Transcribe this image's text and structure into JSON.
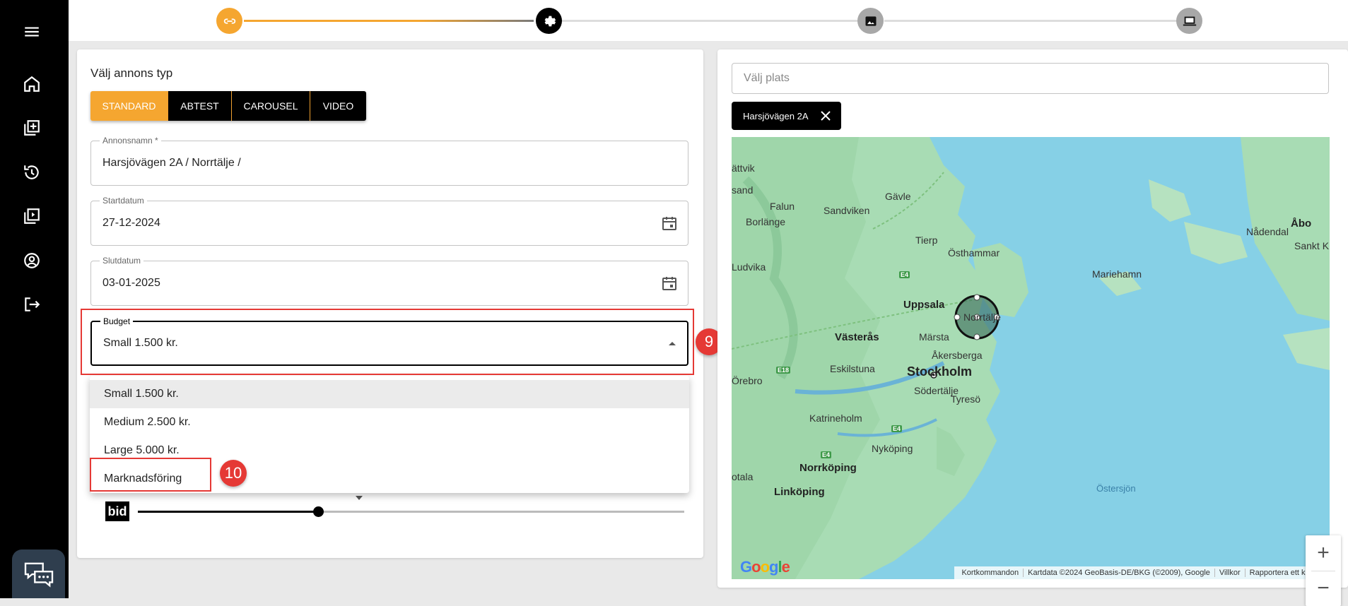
{
  "sidebar": {
    "icons": [
      "menu-icon",
      "home-icon",
      "add-ad-icon",
      "history-icon",
      "video-library-icon",
      "account-icon",
      "logout-icon"
    ],
    "chat": "chat-icon"
  },
  "stepper": {
    "steps": [
      "link-icon",
      "settings-icon",
      "image-icon",
      "laptop-icon"
    ],
    "active_color": "#f5a630"
  },
  "form": {
    "title": "Välj annons typ",
    "ad_types": [
      "STANDARD",
      "ABTEST",
      "CAROUSEL",
      "VIDEO"
    ],
    "active_type": "STANDARD",
    "ad_name": {
      "label": "Annonsnamn *",
      "value": "Harsjövägen 2A / Norrtälje /"
    },
    "start_date": {
      "label": "Startdatum",
      "value": "27-12-2024"
    },
    "end_date": {
      "label": "Slutdatum",
      "value": "03-01-2025"
    },
    "budget": {
      "label": "Budget",
      "value": "Small 1.500 kr.",
      "options": [
        "Small 1.500 kr.",
        "Medium 2.500 kr.",
        "Large 5.000 kr.",
        "Marknadsföring"
      ]
    },
    "bid_label": "bid",
    "bid_slider_fraction": 0.33
  },
  "annotations": {
    "badge_9": "9",
    "badge_10": "10",
    "color": "#e53935"
  },
  "map_panel": {
    "search_placeholder": "Välj plats",
    "chip_label": "Harsjövägen 2A",
    "labels": {
      "ludvika": "Ludvika",
      "falun": "Falun",
      "borlange": "Borlänge",
      "sandviken": "Sandviken",
      "gavle": "Gävle",
      "tierp": "Tierp",
      "osthammar": "Östhammar",
      "uppsala": "Uppsala",
      "vasteras": "Västerås",
      "marsta": "Märsta",
      "norrtalje": "Norrtälje",
      "akersberga": "Åkersberga",
      "stockholm": "Stockholm",
      "eskilstuna": "Eskilstuna",
      "orebro": "Örebro",
      "sodertalje": "Södertälje",
      "tyreso": "Tyresö",
      "katrineholm": "Katrineholm",
      "nykoping": "Nyköping",
      "norrkoping": "Norrköping",
      "linkoping": "Linköping",
      "ostersjon": "Östersjön",
      "mariehamn": "Mariehamn",
      "abo": "Åbo",
      "nadendal": "Nådendal",
      "sankt": "Sankt K",
      "attvik": "ättvik",
      "sand": "sand",
      "otala": "otala"
    },
    "roads": {
      "e4": "E4",
      "e18": "E18"
    },
    "attribution": [
      "Kortkommandon",
      "Kartdata ©2024 GeoBasis-DE/BKG (©2009), Google",
      "Villkor",
      "Rapportera ett kartfel"
    ],
    "google": "Google",
    "zoom_in": "+",
    "zoom_out": "−"
  }
}
